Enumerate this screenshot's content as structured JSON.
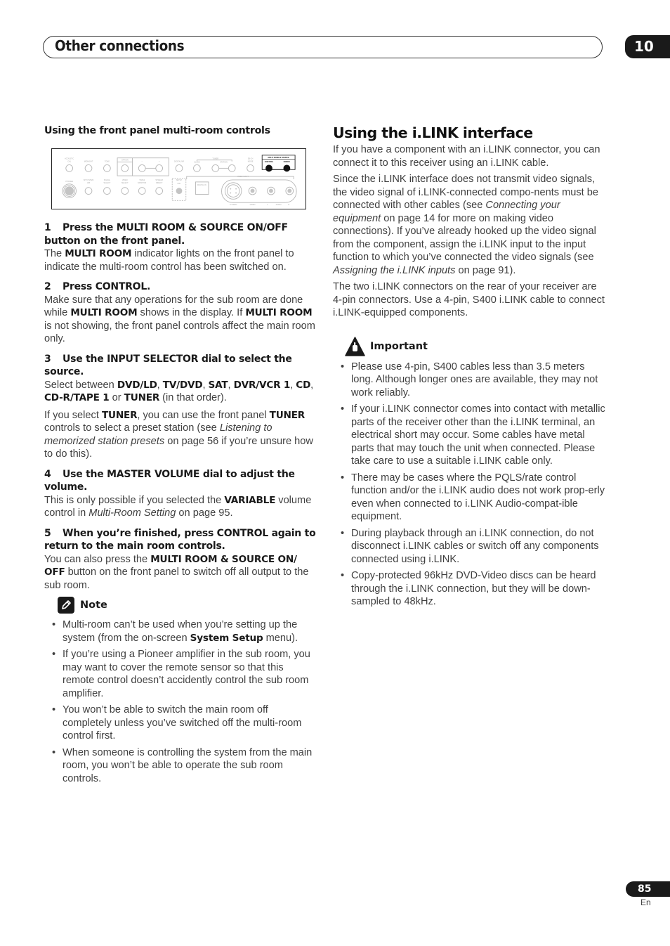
{
  "header": {
    "title": "Other connections",
    "chapter_number": "10"
  },
  "left": {
    "subheading": "Using the front panel multi-room controls",
    "diagram": {
      "labels": {
        "acoustic_cal_1": "ACOUSTIC",
        "acoustic_cal_2": "CAL",
        "midnight": "MIDNIGHT",
        "tone": "TONE",
        "option": "OPTION",
        "minus": "–",
        "plus": "+",
        "digital_nr": "DIGITAL NR",
        "class": "CLASS",
        "tuner": "TUNER",
        "station": "STATION",
        "ch_mode_1": "5B CH",
        "ch_mode_2": "MODE",
        "multiroom_source": "MULTI ROOM & SOURCE",
        "control": "CONTROL",
        "onoff": "ON/OFF",
        "phones": "PHONES",
        "sp_system_1": "SP SYSTEM",
        "sp_system_2": "A/B",
        "signal_select_1": "SIGNAL",
        "signal_select_2": "SELECT",
        "video_select_1": "VIDEO",
        "video_select_2": "SELECT",
        "tape_monitor_1": "TAPE2",
        "tape_monitor_2": "MONITOR",
        "stream_direct_1": "STREAM",
        "stream_direct_2": "DIRECT",
        "setup_mic_1": "SETUP",
        "setup_mic_2": "MIC",
        "digital_in": "DIGITAL IN",
        "video_input": "VIDEO INPUT",
        "s_video": "S-VIDEO",
        "video": "VIDEO",
        "l": "L",
        "audio": "AUDIO",
        "r": "R"
      }
    },
    "steps": [
      {
        "number": "1",
        "heading": "Press the MULTI ROOM & SOURCE ON/OFF button on the front panel.",
        "body": [
          {
            "t": "The "
          },
          {
            "b": "MULTI ROOM"
          },
          {
            "t": " indicator lights on the front panel to indicate the multi-room control has been switched on."
          }
        ]
      },
      {
        "number": "2",
        "heading": "Press CONTROL.",
        "body": [
          {
            "t": "Make sure that any operations for the sub room are done while "
          },
          {
            "b": "MULTI ROOM"
          },
          {
            "t": " shows in the display. If "
          },
          {
            "b": "MULTI ROOM"
          },
          {
            "t": " is not showing, the front panel controls affect the main room only."
          }
        ]
      },
      {
        "number": "3",
        "heading": "Use the INPUT SELECTOR dial to select the source.",
        "body": [
          {
            "t": "Select between "
          },
          {
            "b": "DVD/LD"
          },
          {
            "t": ", "
          },
          {
            "b": "TV/DVD"
          },
          {
            "t": ", "
          },
          {
            "b": "SAT"
          },
          {
            "t": ", "
          },
          {
            "b": "DVR/VCR 1"
          },
          {
            "t": ", "
          },
          {
            "b": "CD"
          },
          {
            "t": ", "
          },
          {
            "b": "CD-R/TAPE 1"
          },
          {
            "t": " or "
          },
          {
            "b": "TUNER"
          },
          {
            "t": " (in that order)."
          }
        ],
        "body2": [
          {
            "t": "If you select "
          },
          {
            "b": "TUNER"
          },
          {
            "t": ", you can use the front panel "
          },
          {
            "b": "TUNER"
          },
          {
            "t": " controls to select a preset station (see "
          },
          {
            "i": "Listening to memorized station presets"
          },
          {
            "t": " on page 56 if you’re unsure how to do this)."
          }
        ]
      },
      {
        "number": "4",
        "heading": "Use the MASTER VOLUME dial to adjust the volume.",
        "body": [
          {
            "t": "This is only possible if you selected the "
          },
          {
            "b": "VARIABLE"
          },
          {
            "t": " volume control in "
          },
          {
            "i": "Multi-Room Setting"
          },
          {
            "t": " on page 95."
          }
        ]
      },
      {
        "number": "5",
        "heading": "When you’re finished, press CONTROL again to return to the main room controls.",
        "body": [
          {
            "t": "You can also press the "
          },
          {
            "b": "MULTI ROOM & SOURCE ON/ OFF"
          },
          {
            "t": " button on the front panel to switch off all output to the sub room."
          }
        ]
      }
    ],
    "note": {
      "icon": "pencil-icon",
      "label": "Note",
      "items": [
        [
          {
            "t": "Multi-room can’t be used when you’re setting up the system (from the on-screen "
          },
          {
            "b": "System Setup"
          },
          {
            "t": " menu)."
          }
        ],
        [
          {
            "t": "If you’re using a Pioneer amplifier in the sub room, you may want to cover the remote sensor so that this remote control doesn’t accidently control the sub room amplifier."
          }
        ],
        [
          {
            "t": "You won’t be able to switch the main room off completely unless you’ve switched off the multi-room control first."
          }
        ],
        [
          {
            "t": "When someone is controlling the system from the main room, you won’t be able to operate the sub room controls."
          }
        ]
      ]
    }
  },
  "right": {
    "heading": "Using the i.LINK interface",
    "paragraphs": [
      [
        {
          "t": "If you have a component with an i.LINK connector, you can connect it to this receiver using an i.LINK cable."
        }
      ],
      [
        {
          "t": "Since the i.LINK interface does not transmit video signals, the video signal of i.LINK-connected compo-nents must be connected with other cables (see "
        },
        {
          "i": "Connecting your equipment"
        },
        {
          "t": " on page 14 for more on making video connections). If you’ve already hooked up the video signal from the component, assign the i.LINK input to the input function to which you’ve connected the video signals (see "
        },
        {
          "i": "Assigning the i.LINK inputs"
        },
        {
          "t": " on page 91)."
        }
      ],
      [
        {
          "t": "The two i.LINK connectors on the rear of your receiver are 4-pin connectors. Use a 4-pin, S400 i.LINK cable to connect i.LINK-equipped components."
        }
      ]
    ],
    "important": {
      "icon": "warning-hand-icon",
      "label": "Important",
      "items": [
        [
          {
            "t": "Please use 4-pin, S400 cables less than 3.5 meters long. Although longer ones are available, they may not work reliably."
          }
        ],
        [
          {
            "t": "If your i.LINK connector comes into contact with metallic parts of the receiver other than the i.LINK terminal, an electrical short may occur. Some cables have metal parts that may touch the unit when connected. Please take care to use a suitable i.LINK cable only."
          }
        ],
        [
          {
            "t": "There may be cases where the PQLS/rate control function and/or the i.LINK audio does not work prop-erly even when connected to i.LINK Audio-compat-ible equipment."
          }
        ],
        [
          {
            "t": "During playback through an i.LINK connection, do not disconnect i.LINK cables or switch off any components connected using i.LINK."
          }
        ],
        [
          {
            "t": "Copy-protected 96kHz DVD-Video discs can be heard through the i.LINK connection, but they will be down-sampled to 48kHz."
          }
        ]
      ]
    }
  },
  "footer": {
    "page_number": "85",
    "language": "En"
  }
}
